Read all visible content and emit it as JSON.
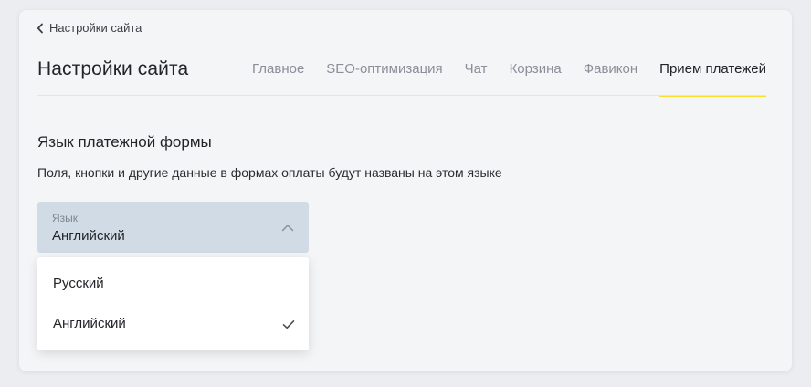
{
  "header": {
    "back_label": "Настройки сайта",
    "title": "Настройки сайта"
  },
  "tabs": [
    {
      "label": "Главное",
      "active": false
    },
    {
      "label": "SEO-оптимизация",
      "active": false
    },
    {
      "label": "Чат",
      "active": false
    },
    {
      "label": "Корзина",
      "active": false
    },
    {
      "label": "Фавикон",
      "active": false
    },
    {
      "label": "Прием платежей",
      "active": true
    }
  ],
  "section": {
    "title": "Язык платежной формы",
    "description": "Поля, кнопки и другие данные в формах оплаты будут названы на этом языке"
  },
  "language_select": {
    "label": "Язык",
    "value": "Английский",
    "expanded": true,
    "options": [
      {
        "label": "Русский",
        "selected": false
      },
      {
        "label": "Английский",
        "selected": true
      }
    ]
  },
  "colors": {
    "accent": "#ffdd2d",
    "select_bg": "#d1dbe5",
    "page_bg": "#f4f5f7"
  }
}
